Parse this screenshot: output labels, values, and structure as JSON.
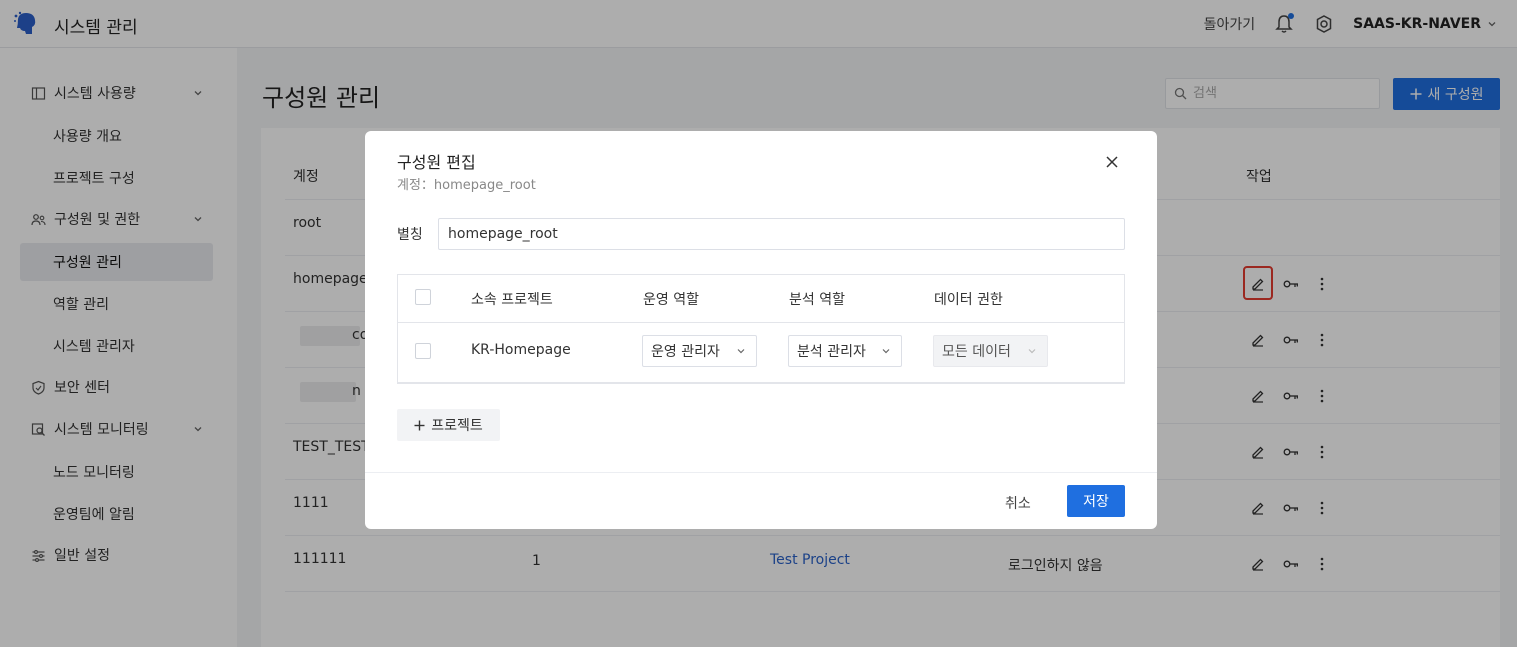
{
  "header": {
    "app_title": "시스템 관리",
    "back_label": "돌아가기",
    "tenant": "SAAS-KR-NAVER",
    "brand_color": "#1f6fe0"
  },
  "sidebar": {
    "groups": [
      {
        "label": "시스템 사용량",
        "icon": "usage-icon",
        "items": [
          "사용량 개요",
          "프로젝트 구성"
        ]
      },
      {
        "label": "구성원 및 권한",
        "icon": "users-icon",
        "items": [
          "구성원 관리",
          "역할 관리",
          "시스템 관리자"
        ]
      },
      {
        "label": "보안 센터",
        "icon": "shield-icon",
        "items": []
      },
      {
        "label": "시스템 모니터링",
        "icon": "monitor-icon",
        "items": [
          "노드 모니터링",
          "운영팀에 알림"
        ]
      },
      {
        "label": "일반 설정",
        "icon": "settings-sliders-icon",
        "items": []
      }
    ],
    "active_item": "구성원 관리"
  },
  "main": {
    "title": "구성원 관리",
    "search_placeholder": "검색",
    "new_member_label": "새 구성원",
    "columns": {
      "account": "계정",
      "actions": "작업"
    },
    "rows": [
      {
        "account": "root"
      },
      {
        "account": "homepage_"
      },
      {
        "account": "co"
      },
      {
        "account": "n"
      },
      {
        "account": "TEST_TEST"
      },
      {
        "account": "1111"
      },
      {
        "account": "111111",
        "count": "1",
        "project": "Test Project",
        "login_status": "로그인하지 않음"
      }
    ]
  },
  "modal": {
    "title": "구성원 편집",
    "subtitle": "계정：homepage_root",
    "alias_label": "별칭",
    "alias_value": "homepage_root",
    "table": {
      "headers": [
        "소속 프로젝트",
        "운영 역할",
        "분석 역할",
        "데이터 권한"
      ],
      "rows": [
        {
          "project": "KR-Homepage",
          "ops_role": "운영 관리자",
          "analysis_role": "분석 관리자",
          "data_perm": "모든 데이터"
        }
      ]
    },
    "add_project_label": "프로젝트",
    "cancel_label": "취소",
    "save_label": "저장"
  }
}
